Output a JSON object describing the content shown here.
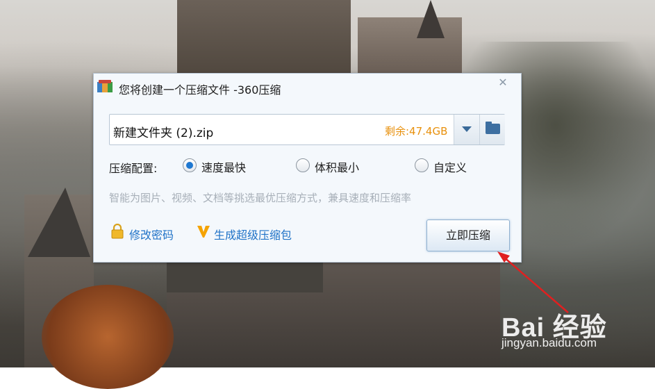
{
  "dialog": {
    "title": "您将创建一个压缩文件 -360压缩",
    "close_symbol": "✕"
  },
  "archive": {
    "filename": "新建文件夹 (2).zip",
    "free_space": "剩余:47.4GB"
  },
  "config": {
    "label": "压缩配置:",
    "options": [
      "速度最快",
      "体积最小",
      "自定义"
    ],
    "selected": "速度最快"
  },
  "description": "智能为图片、视频、文档等挑选最优压缩方式，兼具速度和压缩率",
  "links": {
    "change_password": "修改密码",
    "super_package": "生成超级压缩包"
  },
  "compress_button": "立即压缩",
  "watermark": {
    "logo": "Bai 经验",
    "url": "jingyan.baidu.com"
  },
  "colors": {
    "accent": "#1f72c7",
    "free_space": "#e8900c",
    "arrow": "#e02020"
  }
}
